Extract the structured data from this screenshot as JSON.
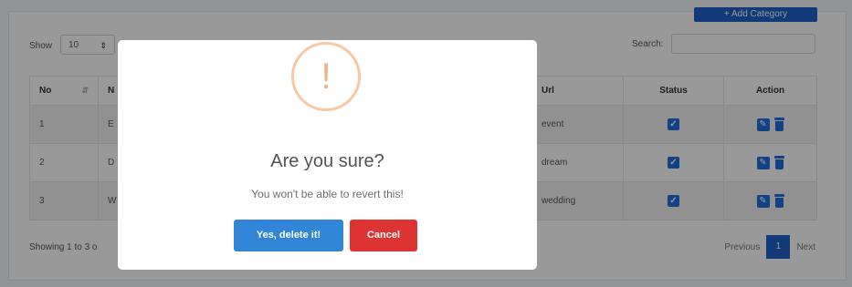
{
  "toolbar": {
    "add_label": "+ Add Category"
  },
  "table_controls": {
    "show_label": "Show",
    "entries_value": "10",
    "search_label": "Search:"
  },
  "table": {
    "headers": [
      "No",
      "N",
      "Url",
      "Status",
      "Action"
    ],
    "rows": [
      {
        "no": "1",
        "name": "E",
        "url": "event"
      },
      {
        "no": "2",
        "name": "D",
        "url": "dream"
      },
      {
        "no": "3",
        "name": "W",
        "url": "wedding"
      }
    ]
  },
  "footer": {
    "info": "Showing 1 to 3 o",
    "previous": "Previous",
    "page": "1",
    "next": "Next"
  },
  "dialog": {
    "icon_glyph": "!",
    "title": "Are you sure?",
    "text": "You won't be able to revert this!",
    "confirm_label": "Yes, delete it!",
    "cancel_label": "Cancel"
  },
  "colors": {
    "primary": "#1f5fc8",
    "confirm": "#3085d6",
    "cancel": "#dd3333",
    "warning": "#f8bb86"
  }
}
